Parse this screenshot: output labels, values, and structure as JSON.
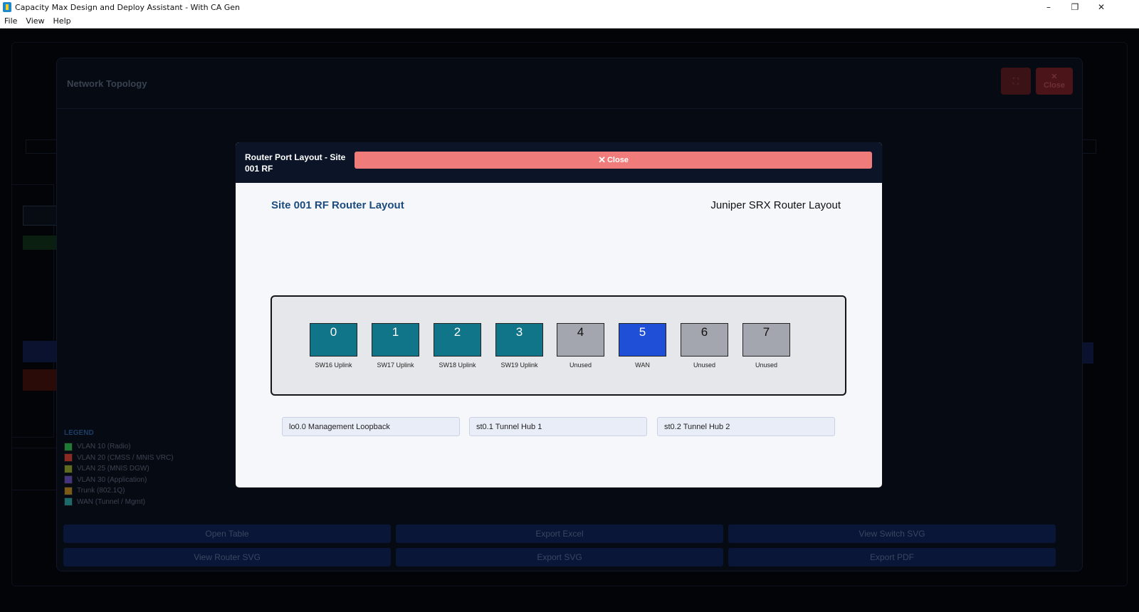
{
  "window": {
    "title": "Capacity Max Design and Deploy Assistant - With CA Gen",
    "controls": {
      "minimize": "–",
      "maximize": "❐",
      "close": "✕"
    }
  },
  "menu": [
    "File",
    "View",
    "Help"
  ],
  "background": {
    "panel_title": "Network Topology",
    "fullscreen_icon": "⛶",
    "close_icon": "✕",
    "close_label": "Close",
    "legend": {
      "title": "LEGEND",
      "items": [
        {
          "label": "VLAN 10 (Radio)",
          "color": "#1e7a35"
        },
        {
          "label": "VLAN 20 (CMSS / MNIS VRC)",
          "color": "#8a2a22"
        },
        {
          "label": "VLAN 25 (MNIS DGW)",
          "color": "#5f6b1e"
        },
        {
          "label": "VLAN 30 (Application)",
          "color": "#43347d"
        },
        {
          "label": "Trunk (802.1Q)",
          "color": "#7a5a14"
        },
        {
          "label": "WAN (Tunnel / Mgmt)",
          "color": "#1a6a6b"
        }
      ]
    },
    "actions": [
      [
        "Open Table",
        "Export Excel",
        "View Switch SVG"
      ],
      [
        "View Router SVG",
        "Export SVG",
        "Export PDF"
      ]
    ]
  },
  "modal": {
    "title": "Router Port Layout - Site 001 RF",
    "close_icon": "✕",
    "close_label": "Close",
    "layout_title": "Site 001 RF Router Layout",
    "layout_subtitle": "Juniper SRX Router Layout",
    "ports": [
      {
        "number": "0",
        "label": "SW16 Uplink",
        "color": "#117589",
        "text_color": "#ffffff"
      },
      {
        "number": "1",
        "label": "SW17 Uplink",
        "color": "#117589",
        "text_color": "#ffffff"
      },
      {
        "number": "2",
        "label": "SW18 Uplink",
        "color": "#117589",
        "text_color": "#ffffff"
      },
      {
        "number": "3",
        "label": "SW19 Uplink",
        "color": "#117589",
        "text_color": "#ffffff"
      },
      {
        "number": "4",
        "label": "Unused",
        "color": "#a3a6ae",
        "text_color": "#111111"
      },
      {
        "number": "5",
        "label": "WAN",
        "color": "#1f4fd6",
        "text_color": "#ffffff"
      },
      {
        "number": "6",
        "label": "Unused",
        "color": "#a3a6ae",
        "text_color": "#111111"
      },
      {
        "number": "7",
        "label": "Unused",
        "color": "#a3a6ae",
        "text_color": "#111111"
      }
    ],
    "interfaces": [
      "lo0.0 Management Loopback",
      "st0.1 Tunnel Hub 1",
      "st0.2 Tunnel Hub 2"
    ]
  }
}
